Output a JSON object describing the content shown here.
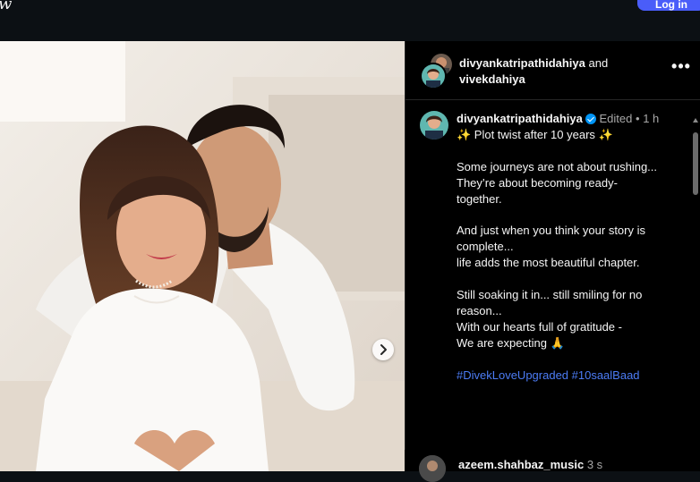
{
  "topbar": {
    "logo_fragment": "w",
    "login_label": "Log in"
  },
  "post": {
    "header": {
      "user1": "divyankatripathidahiya",
      "connector": "and",
      "user2": "vivekdahiya",
      "more_label": "•••"
    },
    "caption": {
      "username": "divyankatripathidahiya",
      "edited": "Edited",
      "dot": "•",
      "time": "1 h",
      "lines": [
        "✨ Plot twist after 10 years ✨",
        "",
        "Some journeys are not about rushing...",
        "They’re about becoming ready-",
        "together.",
        "",
        "And just when you think your story is",
        "complete...",
        "life adds the most beautiful chapter.",
        "",
        "Still soaking it in... still smiling for no",
        "reason...",
        "With our hearts full of gratitude -",
        "We are expecting 🙏"
      ],
      "hashtags": "#DivekLoveUpgraded #10saalBaad"
    },
    "next_comment": {
      "username": "azeem.shahbaz_music",
      "time": "3 s"
    }
  },
  "colors": {
    "accent_blue": "#4a5df9",
    "hashtag": "#4c7cf5",
    "verified": "#0095f6"
  },
  "icons": [
    "chevron-right-icon",
    "more-options-icon",
    "verified-badge-icon",
    "add-circle-icon"
  ]
}
